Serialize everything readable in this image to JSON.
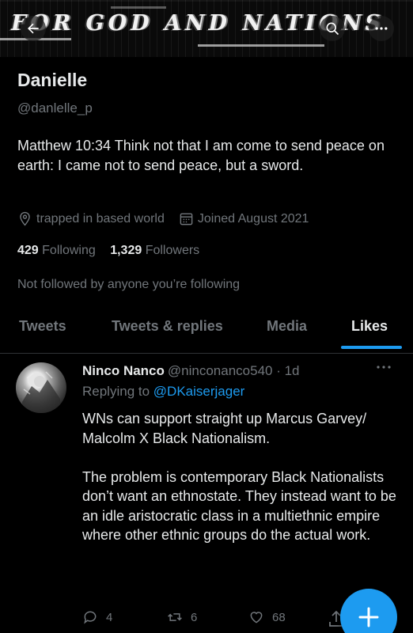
{
  "banner": {
    "text": "FOR GOD AND NATIONS",
    "back_icon": "arrow-left-icon",
    "search_icon": "search-icon",
    "more_icon": "more-horizontal-icon"
  },
  "profile": {
    "name": "Danielle",
    "handle": "@danlelle_p",
    "bio": "Matthew 10:34 Think not that I am come to send peace on earth: I came not to send peace, but a sword.",
    "location": "trapped in based world",
    "joined": "Joined August 2021",
    "following_count": "429",
    "following_label": "Following",
    "followers_count": "1,329",
    "followers_label": "Followers",
    "not_followed": "Not followed by anyone you’re following"
  },
  "tabs": [
    {
      "label": "Tweets",
      "active": false
    },
    {
      "label": "Tweets & replies",
      "active": false
    },
    {
      "label": "Media",
      "active": false
    },
    {
      "label": "Likes",
      "active": true
    }
  ],
  "tweet": {
    "author": "Ninco Nanco",
    "username": "@ninconanco540 · 1d",
    "replying_label": "Replying to ",
    "replying_to": "@DKaiserjager",
    "text": "WNs can support straight up Marcus Garvey/ Malcolm X Black Nationalism.\n\nThe problem is contemporary Black Nationalists don’t want an ethnostate. They instead want to be an idle aristocratic class in a multiethnic empire where other ethnic groups do the actual work.",
    "replies": "4",
    "retweets": "6",
    "likes": "68"
  },
  "colors": {
    "accent": "#1d9bf0",
    "background": "#000000",
    "text": "#e7e9ea",
    "muted": "#71767b"
  }
}
